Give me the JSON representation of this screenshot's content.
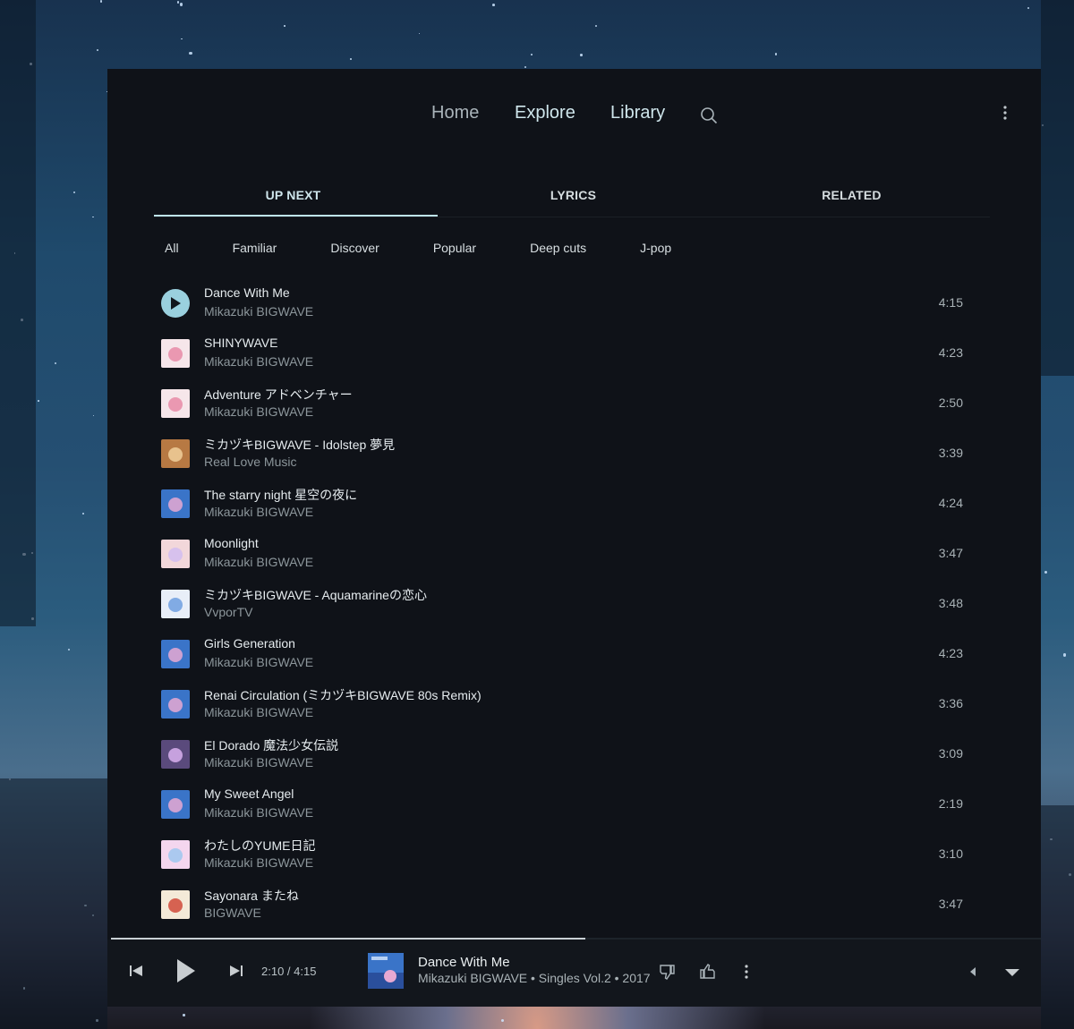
{
  "nav": {
    "home": "Home",
    "explore": "Explore",
    "library": "Library",
    "search_icon": "search-icon",
    "menu_icon": "more-vert-icon"
  },
  "tabs": [
    "UP NEXT",
    "LYRICS",
    "RELATED"
  ],
  "active_tab": "UP NEXT",
  "chips": [
    "All",
    "Familiar",
    "Discover",
    "Popular",
    "Deep cuts",
    "J-pop"
  ],
  "queue": [
    {
      "title": "Dance With Me",
      "artist": "Mikazuki BIGWAVE",
      "duration": "4:15",
      "playing": true
    },
    {
      "title": "SHINYWAVE",
      "artist": "Mikazuki BIGWAVE",
      "duration": "4:23"
    },
    {
      "title": "Adventure アドベンチャー",
      "artist": "Mikazuki BIGWAVE",
      "duration": "2:50"
    },
    {
      "title": "ミカヅキBIGWAVE - Idolstep 夢見",
      "artist": "Real Love Music",
      "duration": "3:39"
    },
    {
      "title": "The starry night 星空の夜に",
      "artist": "Mikazuki BIGWAVE",
      "duration": "4:24"
    },
    {
      "title": "Moonlight",
      "artist": "Mikazuki BIGWAVE",
      "duration": "3:47"
    },
    {
      "title": "ミカヅキBIGWAVE - Aquamarineの恋心",
      "artist": "VvporTV",
      "duration": "3:48"
    },
    {
      "title": "Girls Generation",
      "artist": "Mikazuki BIGWAVE",
      "duration": "4:23"
    },
    {
      "title": "Renai Circulation (ミカヅキBIGWAVE 80s Remix)",
      "artist": "Mikazuki BIGWAVE",
      "duration": "3:36"
    },
    {
      "title": "El Dorado 魔法少女伝説",
      "artist": "Mikazuki BIGWAVE",
      "duration": "3:09"
    },
    {
      "title": "My Sweet Angel",
      "artist": "Mikazuki BIGWAVE",
      "duration": "2:19"
    },
    {
      "title": "わたしのYUME日記",
      "artist": "Mikazuki BIGWAVE",
      "duration": "3:10"
    },
    {
      "title": "Sayonara またね",
      "artist": "BIGWAVE",
      "duration": "3:47"
    }
  ],
  "player": {
    "time": "2:10 / 4:15",
    "progress": 0.51,
    "title": "Dance With Me",
    "subtitle": "Mikazuki BIGWAVE • Singles Vol.2 • 2017"
  },
  "colors": {
    "accent": "#9ad0de",
    "panel_bg": "#0f1218",
    "player_bg": "#12161c"
  }
}
